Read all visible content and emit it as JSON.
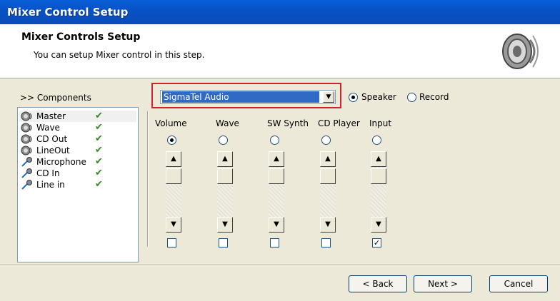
{
  "window": {
    "title": "Mixer Control Setup"
  },
  "header": {
    "title": "Mixer Controls Setup",
    "subtitle": "You can setup Mixer control in this step."
  },
  "components": {
    "title": ">> Components",
    "items": [
      {
        "label": "Master",
        "icon": "speaker-icon",
        "checked": true,
        "selected": true
      },
      {
        "label": "Wave",
        "icon": "speaker-icon",
        "checked": true
      },
      {
        "label": "CD Out",
        "icon": "speaker-icon",
        "checked": true
      },
      {
        "label": "LineOut",
        "icon": "speaker-icon",
        "checked": true
      },
      {
        "label": "Microphone",
        "icon": "microphone-icon",
        "checked": true
      },
      {
        "label": "CD In",
        "icon": "microphone-icon",
        "checked": true
      },
      {
        "label": "Line in",
        "icon": "microphone-icon",
        "checked": true
      }
    ],
    "check_mark": "✔"
  },
  "device": {
    "selected": "SigmaTel Audio",
    "modes": [
      {
        "label": "Speaker",
        "selected": true
      },
      {
        "label": "Record",
        "selected": false
      }
    ]
  },
  "controls": {
    "columns": [
      {
        "label": "Volume",
        "radio_selected": true,
        "checkbox_checked": false
      },
      {
        "label": "Wave",
        "radio_selected": false,
        "checkbox_checked": false
      },
      {
        "label": "SW Synth",
        "radio_selected": false,
        "checkbox_checked": false
      },
      {
        "label": "CD Player",
        "radio_selected": false,
        "checkbox_checked": false
      },
      {
        "label": "Input",
        "radio_selected": false,
        "checkbox_checked": true
      }
    ]
  },
  "footer": {
    "back": "< Back",
    "next": "Next >",
    "cancel": "Cancel"
  },
  "colors": {
    "titlebar": "#0A5FD8",
    "highlight_box": "#D4222A",
    "selection": "#316AC5",
    "check": "#2E8A1E"
  }
}
